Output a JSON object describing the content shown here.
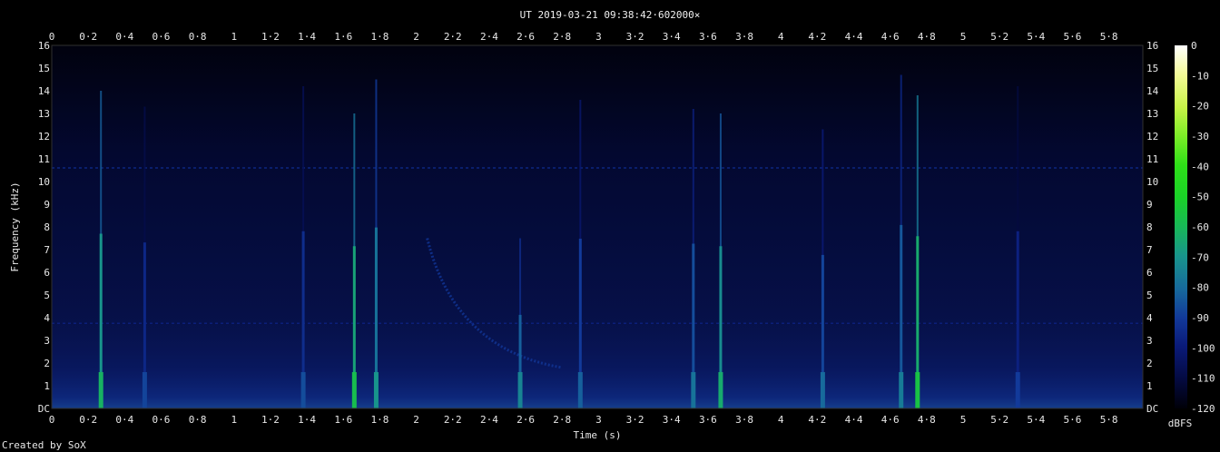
{
  "chart_data": {
    "type": "heatmap",
    "title": "UT 2019-03-21 09:38:42·602000×",
    "xlabel": "Time (s)",
    "ylabel": "Frequency (kHz)",
    "xlim": [
      0,
      5.95
    ],
    "ylim": [
      0,
      16
    ],
    "x_ticks": [
      "0",
      "0·2",
      "0·4",
      "0·6",
      "0·8",
      "1",
      "1·2",
      "1·4",
      "1·6",
      "1·8",
      "2",
      "2·2",
      "2·4",
      "2·6",
      "2·8",
      "3",
      "3·2",
      "3·4",
      "3·6",
      "3·8",
      "4",
      "4·2",
      "4·4",
      "4·6",
      "4·8",
      "5",
      "5·2",
      "5·4",
      "5·6",
      "5·8"
    ],
    "y_ticks": [
      "DC",
      "1",
      "2",
      "3",
      "4",
      "5",
      "6",
      "7",
      "8",
      "9",
      "10",
      "11",
      "12",
      "13",
      "14",
      "15",
      "16"
    ],
    "colorbar": {
      "label": "dBFS",
      "ticks": [
        "0",
        "-10",
        "-20",
        "-30",
        "-40",
        "-50",
        "-60",
        "-70",
        "-80",
        "-90",
        "-100",
        "-110",
        "-120"
      ],
      "range": [
        -120,
        0
      ]
    },
    "grid": false,
    "background_level_dbfs": -110,
    "low_band_level_dbfs": -95,
    "hum_lines": [
      {
        "freq_khz": 10.6,
        "level_dbfs": -95
      },
      {
        "freq_khz": 3.75,
        "level_dbfs": -98
      }
    ],
    "impulses": [
      {
        "time_s": 0.27,
        "top_khz": 14.0,
        "level_dbfs": -62
      },
      {
        "time_s": 0.51,
        "top_khz": 13.3,
        "level_dbfs": -88
      },
      {
        "time_s": 1.38,
        "top_khz": 14.2,
        "level_dbfs": -86
      },
      {
        "time_s": 1.66,
        "top_khz": 13.0,
        "level_dbfs": -58
      },
      {
        "time_s": 1.78,
        "top_khz": 14.5,
        "level_dbfs": -70
      },
      {
        "time_s": 2.57,
        "top_khz": 7.5,
        "level_dbfs": -74
      },
      {
        "time_s": 2.9,
        "top_khz": 13.6,
        "level_dbfs": -82
      },
      {
        "time_s": 3.52,
        "top_khz": 13.2,
        "level_dbfs": -78
      },
      {
        "time_s": 3.67,
        "top_khz": 13.0,
        "level_dbfs": -64
      },
      {
        "time_s": 4.23,
        "top_khz": 12.3,
        "level_dbfs": -80
      },
      {
        "time_s": 4.66,
        "top_khz": 14.7,
        "level_dbfs": -76
      },
      {
        "time_s": 4.75,
        "top_khz": 13.8,
        "level_dbfs": -56
      },
      {
        "time_s": 5.3,
        "top_khz": 14.2,
        "level_dbfs": -90
      }
    ],
    "sweep": {
      "start_time_s": 2.06,
      "start_khz": 7.5,
      "end_time_s": 2.8,
      "end_khz": 1.8,
      "level_dbfs": -92
    }
  },
  "footer": {
    "credit": "Created by SoX"
  }
}
